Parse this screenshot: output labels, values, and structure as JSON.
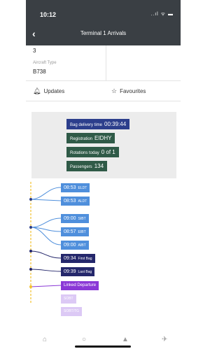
{
  "status": {
    "time": "10:12",
    "icons": "..ıl ᯤ ▬"
  },
  "header": {
    "back_icon": "chevron-left",
    "title": "Terminal 1 Arrivals"
  },
  "info": {
    "number": "3",
    "aircraft_label": "Aircraft Type",
    "aircraft_value": "B738"
  },
  "actions": {
    "updates_label": "Updates",
    "favourites_label": "Favourites"
  },
  "summary": {
    "bag_delivery_label": "Bag delivery time",
    "bag_delivery_value": "00:39:44",
    "registration_label": "Registration",
    "registration_value": "EIDHY",
    "rotations_label": "Rotations today",
    "rotations_value": "0 of 1",
    "passengers_label": "Passengers",
    "passengers_value": "134"
  },
  "timeline": {
    "events": [
      {
        "time": "08:53",
        "code": "ELDT"
      },
      {
        "time": "08:53",
        "code": "ALDT"
      },
      {
        "time": "09:00",
        "code": "SIBT"
      },
      {
        "time": "08:57",
        "code": "EIBT"
      },
      {
        "time": "09:00",
        "code": "AIBT"
      },
      {
        "time": "09:34",
        "code": "First Bag"
      },
      {
        "time": "09:39",
        "code": "Last Bag"
      }
    ],
    "linked_departure_label": "Linked Departure",
    "pending_1": "SOBT",
    "pending_2": "SOBT/TG"
  },
  "nav": {
    "home_icon": "home",
    "chat_icon": "chat",
    "bell_icon": "bell",
    "plane_icon": "plane"
  },
  "colors": {
    "header": "#3a3f44",
    "blue": "#4f8fdc",
    "navy": "#24276b",
    "green": "#2f5a47",
    "purple": "#8a38d6",
    "line_yellow": "#f2c12e"
  }
}
